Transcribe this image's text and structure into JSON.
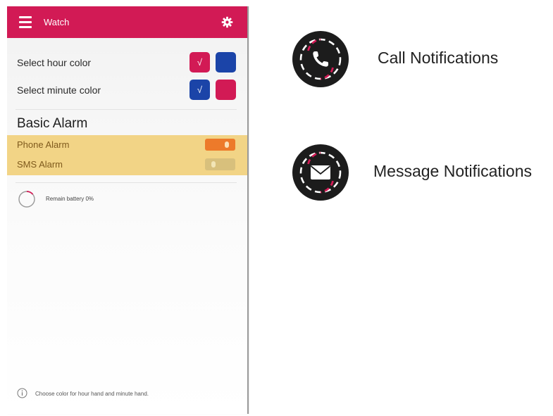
{
  "app": {
    "title": "Watch",
    "menu_icon": "menu-icon",
    "settings_icon": "gear-icon",
    "brand_color": "#d21a55"
  },
  "colors": {
    "hour": {
      "label": "Select hour color",
      "options": [
        {
          "color": "#d21a55",
          "selected": true,
          "mark": "√"
        },
        {
          "color": "#1b44a8",
          "selected": false,
          "mark": ""
        }
      ]
    },
    "minute": {
      "label": "Select minute color",
      "options": [
        {
          "color": "#1b44a8",
          "selected": true,
          "mark": "√"
        },
        {
          "color": "#d21a55",
          "selected": false,
          "mark": ""
        }
      ]
    }
  },
  "alarm": {
    "title": "Basic Alarm",
    "band_color": "#f2d486",
    "items": [
      {
        "label": "Phone Alarm",
        "on": true
      },
      {
        "label": "SMS Alarm",
        "on": false
      }
    ]
  },
  "battery": {
    "text": "Remain battery 0%",
    "percent": 0,
    "icon": "battery-ring-icon"
  },
  "footer": {
    "icon": "info-icon",
    "text": "Choose color for hour hand and minute hand."
  },
  "notifications": [
    {
      "label": "Call Notifications",
      "icon": "phone-icon"
    },
    {
      "label": "Message Notifications",
      "icon": "envelope-icon"
    }
  ]
}
